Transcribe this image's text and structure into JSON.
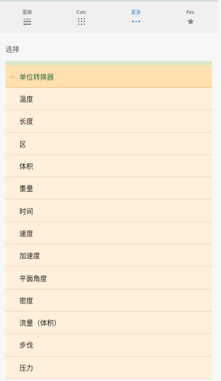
{
  "tabs": [
    {
      "label": "菜单",
      "icon": "menu-icon",
      "active": false
    },
    {
      "label": "Calc",
      "icon": "grid-icon",
      "active": false
    },
    {
      "label": "更多",
      "icon": "more-dots-icon",
      "active": true
    },
    {
      "label": "Fav",
      "icon": "star-icon",
      "active": false
    }
  ],
  "section_title": "选择",
  "converter": {
    "title": "单位转换器",
    "items": [
      "温度",
      "长度",
      "区",
      "体积",
      "重量",
      "时间",
      "速度",
      "加速度",
      "平面角度",
      "密度",
      "流量（体积）",
      "步伐",
      "压力"
    ]
  },
  "colors": {
    "active_tab": "#2f7fd6",
    "header_bg": "#ffe0b0",
    "header_text": "#2a6e3a",
    "item_bg": "#fff0db",
    "stripe": "#d7e8c8"
  }
}
